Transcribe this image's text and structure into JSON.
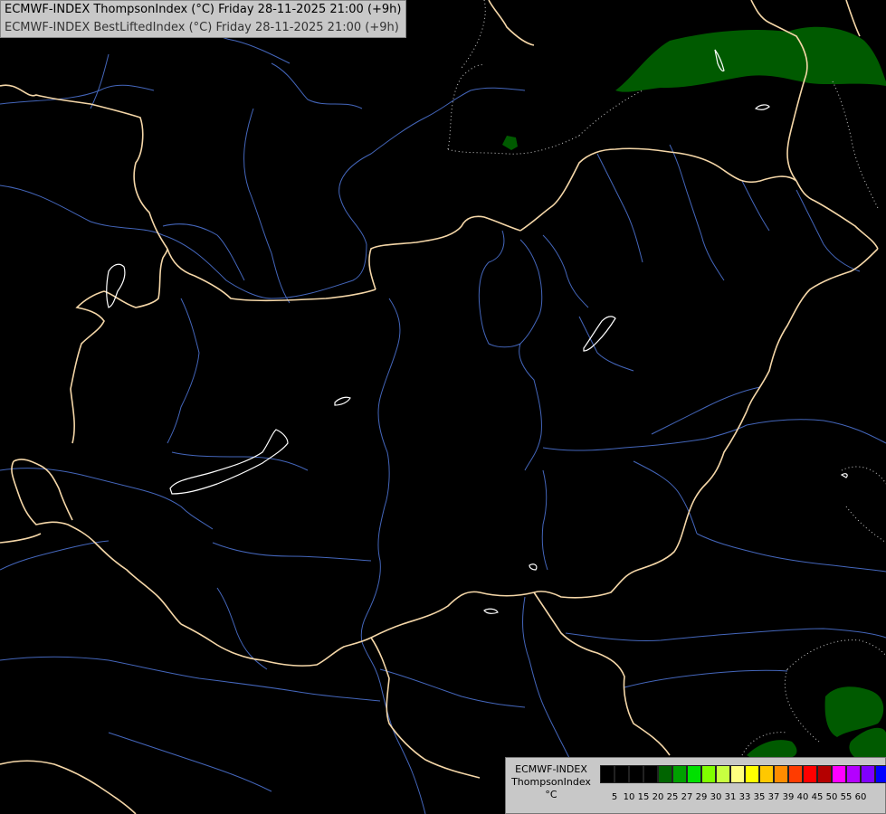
{
  "header": {
    "line1": "ECMWF-INDEX ThompsonIndex (°C) Friday 28-11-2025 21:00 (+9h)",
    "line2": "ECMWF-INDEX BestLiftedIndex (°C) Friday 28-11-2025 21:00 (+9h)"
  },
  "legend": {
    "title_line1": "ECMWF-INDEX",
    "title_line2": "ThompsonIndex",
    "unit": "°C",
    "values": [
      "5",
      "10",
      "15",
      "20",
      "25",
      "27",
      "29",
      "30",
      "31",
      "33",
      "35",
      "37",
      "39",
      "40",
      "45",
      "50",
      "55",
      "60"
    ],
    "colors": [
      "#000000",
      "#000000",
      "#000000",
      "#000000",
      "#006400",
      "#00a000",
      "#00e000",
      "#80ff00",
      "#c8ff40",
      "#ffff80",
      "#ffff00",
      "#ffc800",
      "#ff8c00",
      "#ff3c00",
      "#ff0000",
      "#b40000",
      "#ff00ff",
      "#b400ff",
      "#8000ff",
      "#0000ff"
    ]
  },
  "map_colors": {
    "background": "#000000",
    "borders": "#f5d7a8",
    "rivers": "#4466bb",
    "lakes": "#ffffff",
    "precip_green": "#005a00",
    "dotted": "#cccccc"
  }
}
